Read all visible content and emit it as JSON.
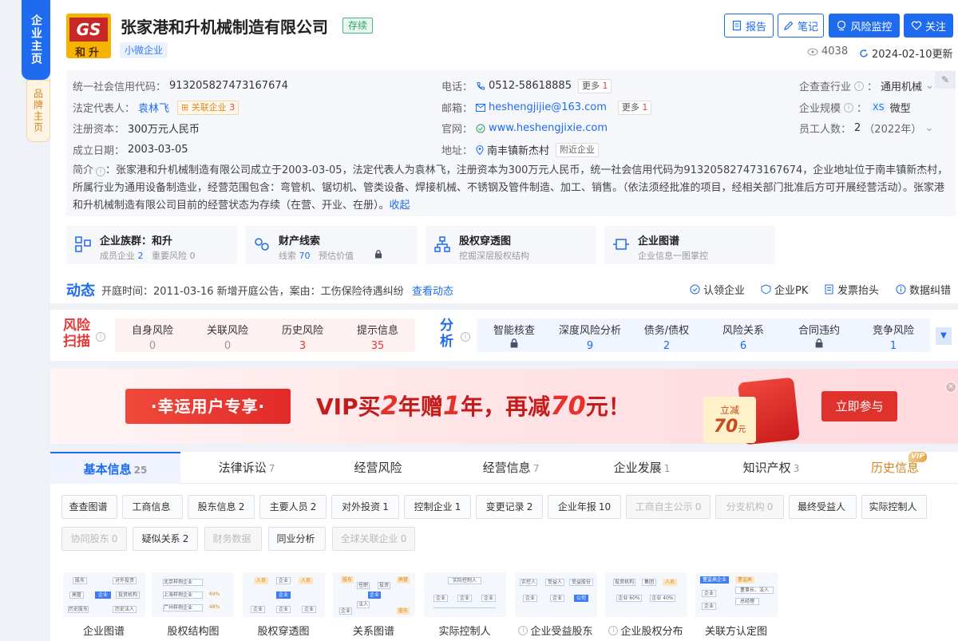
{
  "side_tabs": {
    "main": "企业主页",
    "brand": "品牌主页"
  },
  "company": {
    "logo_text_top": "GS",
    "logo_text_bottom": "和升",
    "name": "张家港和升机械制造有限公司",
    "status": "存续",
    "scale_tag": "小微企业"
  },
  "actions": {
    "report": "报告",
    "notes": "笔记",
    "monitor": "风险监控",
    "follow": "关注"
  },
  "meta": {
    "views": "4038",
    "updated": "2024-02-10更新"
  },
  "info": {
    "credit_code_label": "统一社会信用代码：",
    "credit_code": "913205827473167674",
    "legal_rep_label": "法定代表人：",
    "legal_rep": "袁林飞",
    "related_label": "关联企业",
    "related_count": "3",
    "reg_capital_label": "注册资本：",
    "reg_capital": "300万元人民币",
    "founded_label": "成立日期：",
    "founded": "2003-03-05",
    "phone_label": "电话：",
    "phone": "0512-58618885",
    "phone_more": "更多",
    "phone_more_count": "1",
    "email_label": "邮箱：",
    "email": "heshengjijie@163.com",
    "email_more": "更多",
    "email_more_count": "1",
    "website_label": "官网：",
    "website": "www.heshengjixie.com",
    "address_label": "地址：",
    "address": "南丰镇新杰村",
    "nearby": "附近企业",
    "industry_label": "企查查行业",
    "industry": "通用机械",
    "size_label": "企业规模",
    "size_badge": "XS",
    "size": "微型",
    "staff_label": "员工人数：",
    "staff": "2",
    "staff_year": "（2022年）",
    "intro_label": "简介",
    "intro": "：张家港和升机械制造有限公司成立于2003-03-05，法定代表人为袁林飞，注册资本为300万元人民币，统一社会信用代码为913205827473167674，企业地址位于南丰镇新杰村，所属行业为通用设备制造业，经营范围包含：弯管机、锯切机、管类设备、焊接机械、不锈钢及管件制造、加工、销售。（依法须经批准的项目，经相关部门批准后方可开展经营活动）。张家港和升机械制造有限公司目前的经营状态为存续（在营、开业、在册）。",
    "collapse": "收起"
  },
  "features": [
    {
      "title": "企业族群：和升",
      "sub1": "成员企业",
      "sub1_count": "2",
      "sub2": "重要风险",
      "sub2_count": "0"
    },
    {
      "title": "财产线索",
      "sub1": "线索",
      "sub1_count": "70",
      "sub2": "预估价值",
      "sub2_count": ""
    },
    {
      "title": "股权穿透图",
      "sub1": "挖掘深层股权结构",
      "sub1_count": "",
      "sub2": "",
      "sub2_count": ""
    },
    {
      "title": "企业图谱",
      "sub1": "企业信息一图掌控",
      "sub1_count": "",
      "sub2": "",
      "sub2_count": ""
    }
  ],
  "dynamic": {
    "label": "动态",
    "text": "开庭时间：2011-03-16 新增开庭公告，案由：工伤保险待遇纠纷",
    "link": "查看动态",
    "actions": [
      "认领企业",
      "企业PK",
      "发票抬头",
      "数据纠错"
    ]
  },
  "risk": {
    "title": "风险扫描",
    "cells": [
      {
        "label": "自身风险",
        "value": "0"
      },
      {
        "label": "关联风险",
        "value": "0"
      },
      {
        "label": "历史风险",
        "value": "3"
      },
      {
        "label": "提示信息",
        "value": "35"
      }
    ]
  },
  "analysis": {
    "title": "分析",
    "cells": [
      {
        "label": "智能核查",
        "value": ""
      },
      {
        "label": "深度风险分析",
        "value": "9"
      },
      {
        "label": "债务/债权",
        "value": "2"
      },
      {
        "label": "风险关系",
        "value": "6"
      },
      {
        "label": "合同违约",
        "value": ""
      },
      {
        "label": "竞争风险",
        "value": "1"
      }
    ]
  },
  "banner": {
    "pill": "·幸运用户专享·",
    "text_a": "VIP买",
    "num_a": "2",
    "text_b": "年赠",
    "num_b": "1",
    "text_c": "年，再减",
    "num_c": "70",
    "text_d": "元！",
    "coupon_a": "立减",
    "coupon_b": "70",
    "coupon_unit": "元",
    "cta": "立即参与"
  },
  "tabs": [
    {
      "label": "基本信息",
      "count": "25"
    },
    {
      "label": "法律诉讼",
      "count": "7"
    },
    {
      "label": "经营风险",
      "count": ""
    },
    {
      "label": "经营信息",
      "count": "7"
    },
    {
      "label": "企业发展",
      "count": "1"
    },
    {
      "label": "知识产权",
      "count": "3"
    },
    {
      "label": "历史信息",
      "count": ""
    }
  ],
  "vip_badge": "VIP",
  "chips_row1": [
    {
      "label": "查查图谱",
      "count": ""
    },
    {
      "label": "工商信息",
      "count": ""
    },
    {
      "label": "股东信息",
      "count": "2"
    },
    {
      "label": "主要人员",
      "count": "2"
    },
    {
      "label": "对外投资",
      "count": "1"
    },
    {
      "label": "控制企业",
      "count": "1"
    },
    {
      "label": "变更记录",
      "count": "2"
    },
    {
      "label": "企业年报",
      "count": "10"
    },
    {
      "label": "工商自主公示",
      "count": "0"
    },
    {
      "label": "分支机构",
      "count": "0"
    },
    {
      "label": "最终受益人",
      "count": ""
    },
    {
      "label": "实际控制人",
      "count": ""
    }
  ],
  "chips_row2": [
    {
      "label": "协同股东",
      "count": "0"
    },
    {
      "label": "疑似关系",
      "count": "2"
    },
    {
      "label": "财务数据",
      "count": ""
    },
    {
      "label": "同业分析",
      "count": ""
    },
    {
      "label": "全球关联企业",
      "count": "0"
    }
  ],
  "diagrams": [
    {
      "label": "企业图谱"
    },
    {
      "label": "股权结构图"
    },
    {
      "label": "股权穿透图"
    },
    {
      "label": "关系图谱"
    },
    {
      "label": "实际控制人"
    },
    {
      "label": "企业受益股东"
    },
    {
      "label": "企业股权分布"
    },
    {
      "label": "关联方认定图"
    }
  ],
  "diagram_texts": {
    "d1": [
      "股东",
      "对外投资",
      "高管",
      "企业",
      "投资机构",
      "历史股东",
      "历史法人"
    ],
    "d2": [
      "北京样例企业",
      "上海样例企业",
      "广州样例企业",
      "69%",
      "48%"
    ],
    "d3": [
      "人员",
      "企业",
      "人员",
      "企业",
      "企业",
      "企业",
      "企业"
    ],
    "d4": [
      "股东",
      "任职",
      "投资",
      "企业",
      "高管",
      "法人",
      "企业",
      "股东"
    ],
    "d5": [
      "实际控制人",
      "企业",
      "企业",
      "企业"
    ],
    "d6": [
      "实控人",
      "受益人",
      "受益股份",
      "企业",
      "企业",
      "公司"
    ],
    "d7": [
      "投资机构",
      "集团",
      "人员",
      "企业 60%",
      "企业 40%"
    ],
    "d8": [
      "董监高企业",
      "董监高",
      "企业",
      "董事长、法人",
      "企业",
      "总经理"
    ]
  }
}
